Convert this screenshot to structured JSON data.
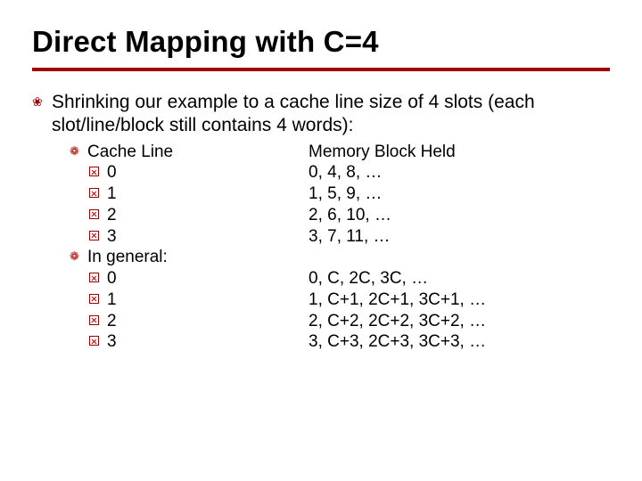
{
  "title": "Direct Mapping with C=4",
  "intro": "Shrinking our example to a cache line size of 4 slots (each slot/line/block still contains 4 words):",
  "section1": {
    "left_header": "Cache Line",
    "right_header": "Memory Block Held",
    "rows": [
      {
        "line": "0",
        "mem": "0, 4, 8, …"
      },
      {
        "line": "1",
        "mem": "1, 5, 9, …"
      },
      {
        "line": "2",
        "mem": "2, 6, 10, …"
      },
      {
        "line": "3",
        "mem": "3, 7, 11, …"
      }
    ]
  },
  "section2": {
    "header": "In general:",
    "rows": [
      {
        "line": "0",
        "mem": "0, C, 2C, 3C, …"
      },
      {
        "line": "1",
        "mem": "1, C+1, 2C+1, 3C+1, …"
      },
      {
        "line": "2",
        "mem": "2, C+2, 2C+2, 3C+2, …"
      },
      {
        "line": "3",
        "mem": "3, C+3, 2C+3, 3C+3, …"
      }
    ]
  },
  "bullets": {
    "lvl1": "❀",
    "lvl2": "❁"
  }
}
